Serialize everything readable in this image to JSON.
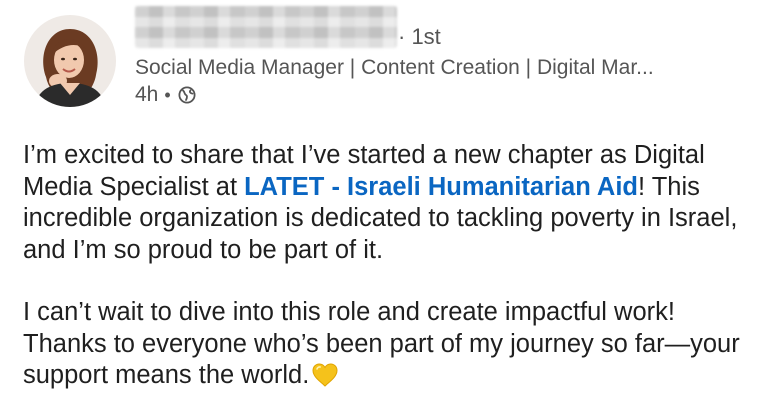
{
  "author": {
    "connection_degree": "· 1st",
    "headline": "Social Media Manager | Content Creation | Digital Mar...",
    "posted_time": "4h",
    "separator": "•",
    "visibility_icon": "globe-icon"
  },
  "post": {
    "paragraph1_before": "I’m excited to share that I’ve started a new chapter as Digital Media Specialist at ",
    "company_link": "LATET - Israeli Humanitarian Aid",
    "paragraph1_after": "! This incredible organization is dedicated to tackling poverty in Israel, and I’m so proud to be part of it.",
    "paragraph2": "I can’t wait to dive into this role and create impactful work! Thanks to everyone who’s been part of my journey so far—your support means the world.",
    "emoji": "yellow-heart-icon"
  },
  "colors": {
    "link": "#0a66c2",
    "meta_text": "#555555",
    "body_text": "#1f1f1f",
    "heart": "#f5c21b"
  }
}
